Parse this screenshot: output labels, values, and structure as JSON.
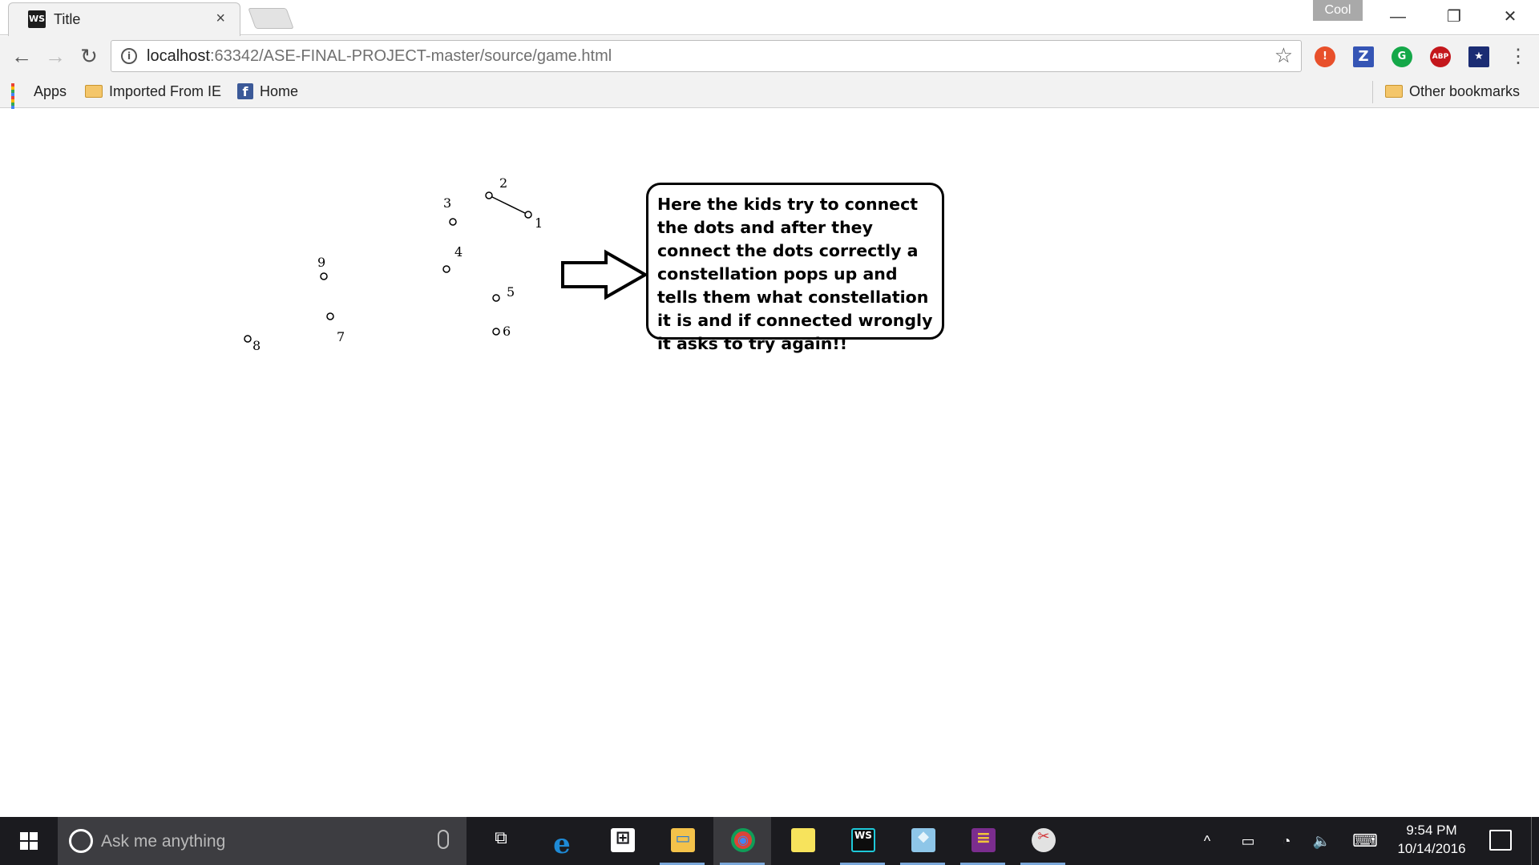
{
  "browser": {
    "tab": {
      "favicon": "WS",
      "title": "Title",
      "close": "×"
    },
    "profile": "Cool",
    "window_controls": {
      "minimize": "—",
      "restore": "❐",
      "close": "✕"
    },
    "nav": {
      "back": "←",
      "forward": "→",
      "reload": "↻",
      "info": "i",
      "bookmark_star": "☆",
      "menu": "⋮"
    },
    "address": {
      "host": "localhost",
      "path": ":63342/ASE-FINAL-PROJECT-master/source/game.html"
    },
    "extensions": [
      "!",
      "Z",
      "G",
      "ABP",
      "★"
    ],
    "bookmarks": [
      {
        "label": "Apps",
        "icon": "apps-grid-icon"
      },
      {
        "label": "Imported From IE",
        "icon": "folder-icon"
      },
      {
        "label": "Home",
        "icon": "facebook-icon"
      }
    ],
    "other_bookmarks": "Other bookmarks"
  },
  "game": {
    "dot_labels": [
      "1",
      "2",
      "3",
      "4",
      "5",
      "6",
      "7",
      "8",
      "9"
    ],
    "callout_text": "Here the kids try to connect the dots and after they connect the dots correctly a constellation pops up and tells them what constellation it is and if connected wrongly it asks to try again!!",
    "arrow": "right-arrow-icon"
  },
  "taskbar": {
    "search_placeholder": "Ask me anything",
    "apps": [
      {
        "name": "task-view",
        "glyph": "⧉"
      },
      {
        "name": "edge",
        "glyph": "e"
      },
      {
        "name": "store",
        "glyph": "⊞"
      },
      {
        "name": "file-explorer",
        "glyph": "▭"
      },
      {
        "name": "chrome",
        "glyph": "◉"
      },
      {
        "name": "sticky-notes",
        "glyph": "▮"
      },
      {
        "name": "webstorm",
        "glyph": "WS"
      },
      {
        "name": "app-blue",
        "glyph": "◆"
      },
      {
        "name": "winrar",
        "glyph": "≡"
      },
      {
        "name": "snipping-tool",
        "glyph": "✂"
      }
    ],
    "tray": {
      "chevron": "^",
      "battery": "▭",
      "wifi": "◔",
      "volume": "🔈",
      "keyboard": "⌨"
    },
    "clock": {
      "time": "9:54 PM",
      "date": "10/14/2016"
    }
  },
  "colors": {
    "taskbar": "#1b1b1f",
    "search_box": "#3d3d41",
    "toolbar": "#f2f2f2",
    "ext_orange": "#e8502b",
    "ext_blue": "#3555b5",
    "ext_green": "#15a849",
    "ext_red": "#c4171c"
  }
}
